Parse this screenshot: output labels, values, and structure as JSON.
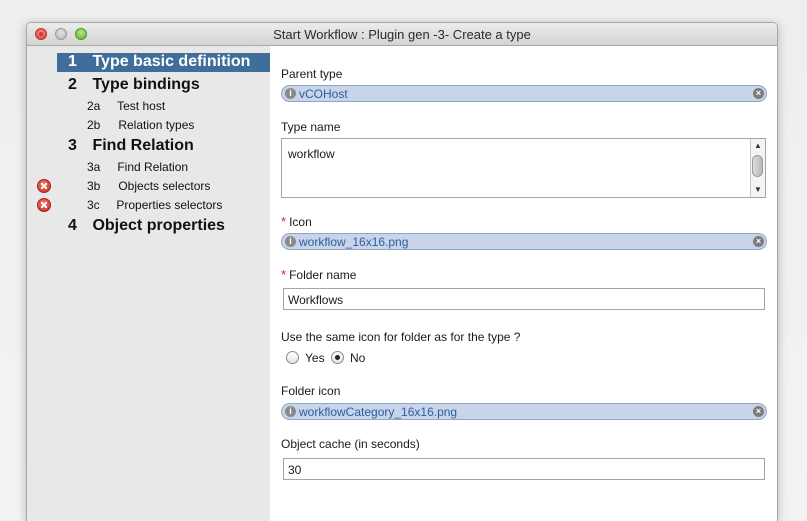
{
  "window": {
    "title": "Start Workflow : Plugin gen -3- Create a type"
  },
  "steps": [
    {
      "num": "1",
      "label": "Type basic definition",
      "level": "main",
      "selected": true,
      "error": false
    },
    {
      "num": "2",
      "label": "Type bindings",
      "level": "main",
      "selected": false,
      "error": false
    },
    {
      "num": "2a",
      "label": "Test host",
      "level": "sub",
      "selected": false,
      "error": false
    },
    {
      "num": "2b",
      "label": "Relation types",
      "level": "sub",
      "selected": false,
      "error": false
    },
    {
      "num": "3",
      "label": "Find Relation",
      "level": "main",
      "selected": false,
      "error": false
    },
    {
      "num": "3a",
      "label": "Find Relation",
      "level": "sub",
      "selected": false,
      "error": false
    },
    {
      "num": "3b",
      "label": "Objects selectors",
      "level": "sub",
      "selected": false,
      "error": true
    },
    {
      "num": "3c",
      "label": "Properties selectors",
      "level": "sub",
      "selected": false,
      "error": true
    },
    {
      "num": "4",
      "label": "Object properties",
      "level": "main",
      "selected": false,
      "error": false
    }
  ],
  "form": {
    "parent_type": {
      "label": "Parent type",
      "value": "vCOHost"
    },
    "type_name": {
      "label": "Type name",
      "value": "workflow"
    },
    "icon": {
      "label": "Icon",
      "required_mark": "*",
      "value": "workflow_16x16.png"
    },
    "folder_name": {
      "label": "Folder name",
      "required_mark": "*",
      "value": "Workflows"
    },
    "same_icon": {
      "question": "Use the same icon for folder as for the type ?",
      "yes_label": "Yes",
      "no_label": "No",
      "selected": "No"
    },
    "folder_icon": {
      "label": "Folder icon",
      "value": "workflowCategory_16x16.png"
    },
    "object_cache": {
      "label": "Object cache (in seconds)",
      "value": "30"
    }
  },
  "icons": {
    "info": "info-icon",
    "clear": "clear-icon",
    "error": "error-icon"
  },
  "colors": {
    "selected_step": "#3f6e9a",
    "pill_fill": "#c7d4e9",
    "pill_text": "#2f5e9c",
    "required": "#d8281c",
    "error": "#c7281e"
  }
}
